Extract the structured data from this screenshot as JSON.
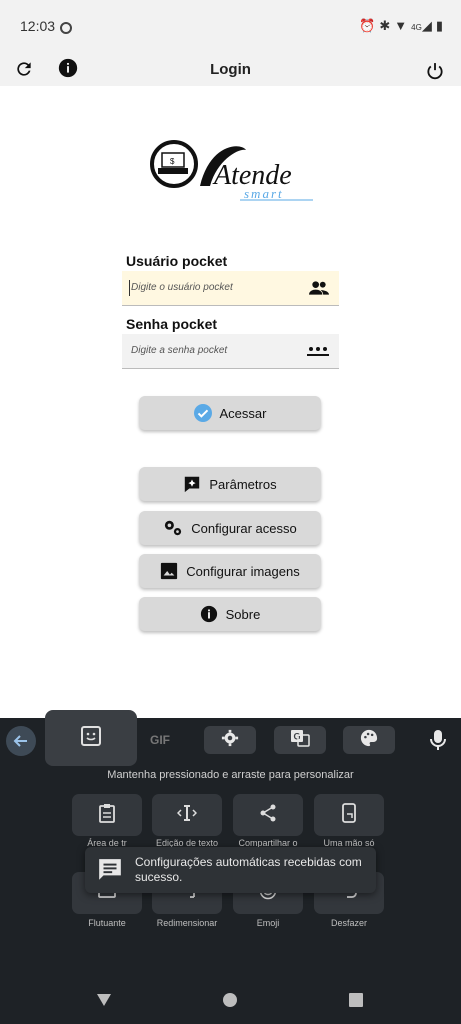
{
  "status": {
    "time": "12:03",
    "net": "4G"
  },
  "appbar": {
    "title": "Login"
  },
  "logo": {
    "main": "Atende",
    "sub": "smart"
  },
  "form": {
    "user_label": "Usuário pocket",
    "user_placeholder": "Digite o usuário pocket",
    "pass_label": "Senha pocket",
    "pass_placeholder": "Digite a senha pocket"
  },
  "buttons": {
    "login": "Acessar",
    "params": "Parâmetros",
    "config_access": "Configurar acesso",
    "config_images": "Configurar imagens",
    "about": "Sobre"
  },
  "keyboard": {
    "gif": "GIF",
    "hint": "Mantenha pressionado e arraste para personalizar",
    "tiles": [
      {
        "label": "Área de tr",
        "icon": "clipboard-icon"
      },
      {
        "label": "Edição de texto",
        "icon": "text-cursor-icon"
      },
      {
        "label": "Compartilhar o",
        "icon": "share-icon"
      },
      {
        "label": "Uma mão só",
        "icon": "one-hand-icon"
      },
      {
        "label": "Flutuante",
        "icon": "floating-icon"
      },
      {
        "label": "Redimensionar",
        "icon": "resize-icon"
      },
      {
        "label": "Emoji",
        "icon": "emoji-icon"
      },
      {
        "label": "Desfazer",
        "icon": "undo-icon"
      }
    ]
  },
  "toast": {
    "message": "Configurações automáticas recebidas com sucesso."
  },
  "colors": {
    "accent_blue": "#5aa9e6",
    "field_highlight": "#fff8e1",
    "keyboard_bg": "#1e2226"
  }
}
